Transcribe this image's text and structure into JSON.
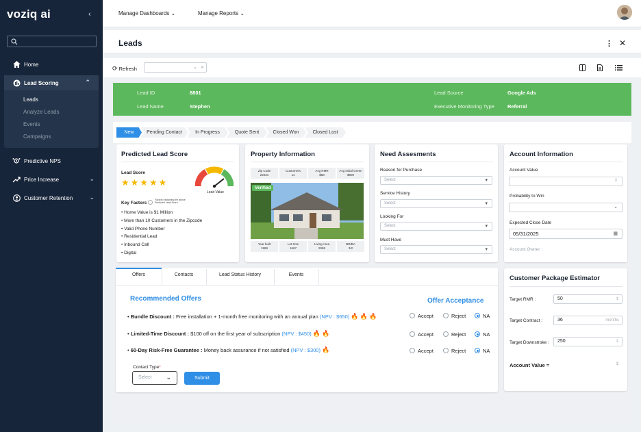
{
  "app": {
    "logo": "voziq ai"
  },
  "sidebar": {
    "items": [
      {
        "label": "Home",
        "icon": "home-icon"
      },
      {
        "label": "Lead Scoring",
        "icon": "lead-scoring-icon"
      },
      {
        "label": "Predictive NPS",
        "icon": "nps-icon"
      },
      {
        "label": "Price Increase",
        "icon": "price-increase-icon"
      },
      {
        "label": "Customer Retention",
        "icon": "customer-retention-icon"
      }
    ],
    "subitems": [
      "Leads",
      "Analyze Leads",
      "Events",
      "Campaigns"
    ]
  },
  "topbar": {
    "menu1": "Manage Dashboards",
    "menu2": "Manage Reports"
  },
  "page": {
    "title": "Leads",
    "refresh": "Refresh"
  },
  "lead": {
    "id_label": "Lead ID",
    "id": "8801",
    "name_label": "Lead Name",
    "name": "Stephen",
    "source_label": "Lead Source",
    "source": "Google Ads",
    "emt_label": "Executive Monitoring Type",
    "emt": "Referral"
  },
  "stages": [
    "New",
    "Pending Contact",
    "In Progress",
    "Quote Sent",
    "Closed Won",
    "Closed Lost"
  ],
  "predicted": {
    "title": "Predicted Lead Score",
    "score_label": "Lead Score",
    "stars": 5,
    "gauge_label": "Lead Value",
    "gauge_segments": [
      "Low",
      "Mid",
      "High"
    ],
    "key_factors_label": "Key Factors",
    "key_factors_note": "Factors explaining the above Predicted Lead Score",
    "factors": [
      "Home Value is $1 Million",
      "More than 10 Customers in the Zipcode",
      "Valid Phone Number",
      "Residential Lead",
      "Inbound Call",
      "Digital"
    ]
  },
  "property": {
    "title": "Property Information",
    "top": [
      {
        "label": "Zip Code",
        "value": "22031"
      },
      {
        "label": "Customers",
        "value": "11"
      },
      {
        "label": "Avg RMR",
        "value": "$58"
      },
      {
        "label": "Avg Initial Green",
        "value": "$900"
      }
    ],
    "verified": "Verified",
    "bottom": [
      {
        "label": "Year built",
        "value": "1989"
      },
      {
        "label": "Lot Size",
        "value": "1667"
      },
      {
        "label": "Living Area",
        "value": "2998"
      },
      {
        "label": "BR/BA",
        "value": "3/2"
      }
    ]
  },
  "needs": {
    "title": "Need Assesments",
    "fields": [
      {
        "label": "Reason for Purchase",
        "value": "Select"
      },
      {
        "label": "Service History",
        "value": "Select"
      },
      {
        "label": "Looking For",
        "value": "Select"
      },
      {
        "label": "Must Have",
        "value": "Select"
      }
    ]
  },
  "account": {
    "title": "Account Information",
    "value_label": "Account Value",
    "prob_label": "Probability to Win",
    "close_label": "Expected Close Date",
    "close_date": "05/31/2025",
    "owner_label": "Account Owner :"
  },
  "tabs": [
    "Offers",
    "Contacts",
    "Lead Status History",
    "Events"
  ],
  "offers": {
    "title": "Recommended Offers",
    "acceptance": "Offer Acceptance",
    "items": [
      {
        "name": "Bundle Discount :",
        "desc": "Free installation + 1-month free monitoring with an annual plan",
        "npv": "(NPV : $650)"
      },
      {
        "name": "Limited-Time Discount :",
        "desc": "$100 off on the first year of subscription",
        "npv": "(NPV : $450)"
      },
      {
        "name": "60-Day Risk-Free Guarantee :",
        "desc": "Money back assurance if not satisfied",
        "npv": "(NPV : $300)"
      }
    ],
    "options": [
      "Accept",
      "Reject",
      "NA"
    ],
    "contact_type_label": "Contact Type",
    "contact_type_value": "Select",
    "submit": "Submit"
  },
  "estimator": {
    "title": "Customer Package Estimator",
    "rmr_label": "Target RMR :",
    "rmr": "50",
    "contract_label": "Target Contract :",
    "contract": "36",
    "contract_unit": "months",
    "down_label": "Target Downstroke :",
    "down": "250",
    "acct_label": "Account Value =",
    "acct_unit": "$"
  },
  "colors": {
    "sidebar": "#17253a",
    "green": "#5cb85c",
    "accent": "#2f8ee5"
  }
}
